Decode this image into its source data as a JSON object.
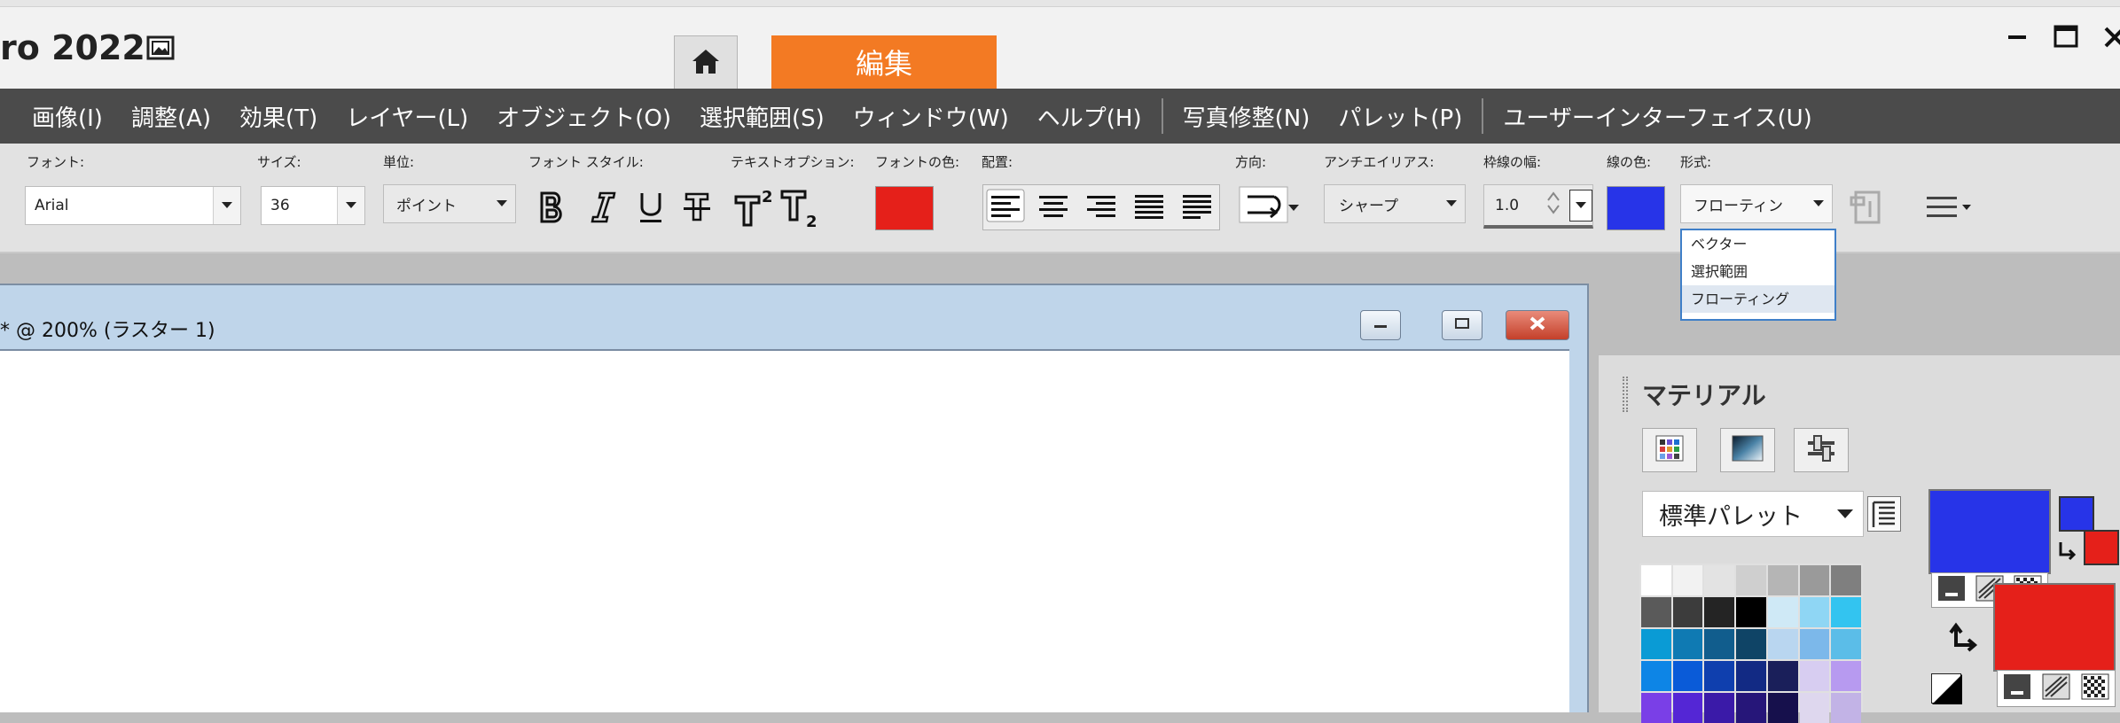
{
  "app": {
    "title": "ro 2022",
    "tabs": {
      "edit": "編集"
    }
  },
  "menu": [
    "画像(I)",
    "調整(A)",
    "効果(T)",
    "レイヤー(L)",
    "オブジェクト(O)",
    "選択範囲(S)",
    "ウィンドウ(W)",
    "ヘルプ(H)",
    "|",
    "写真修整(N)",
    "パレット(P)",
    "|",
    "ユーザーインターフェイス(U)"
  ],
  "toolbar": {
    "labels": {
      "font": "フォント:",
      "size": "サイズ:",
      "unit": "単位:",
      "font_style": "フォント スタイル:",
      "text_options": "テキストオプション:",
      "font_color": "フォントの色:",
      "alignment": "配置:",
      "direction": "方向:",
      "antialias": "アンチエイリアス:",
      "stroke_width": "枠線の幅:",
      "stroke_color": "線の色:",
      "format": "形式:"
    },
    "font": "Arial",
    "size": "36",
    "unit": "ポイント",
    "antialias": "シャープ",
    "stroke_width": "1.0",
    "format": "フローティン",
    "font_color": "#e5201a",
    "stroke_color": "#2734e8"
  },
  "format_dropdown": [
    "ベクター",
    "選択範囲",
    "フローティング"
  ],
  "document": {
    "title": "* @ 200% (ラスター 1)"
  },
  "materials": {
    "title": "マテリアル",
    "palette": "標準パレット",
    "foreground": "#2734e8",
    "background": "#e5201a",
    "swatches": [
      "#ffffff",
      "#f2f2f2",
      "#e3e3e3",
      "#cfcfcf",
      "#b5b5b5",
      "#9a9a9a",
      "#7f7f7f",
      "#5a5a5a",
      "#3c3c3c",
      "#242424",
      "#000000",
      "#cfe9f6",
      "#8fd6f4",
      "#33c4f0",
      "#0a9bd5",
      "#0f7ab3",
      "#115d8d",
      "#0f4466",
      "#b9d6f0",
      "#7cb8ea",
      "#5bbde8",
      "#0d85e6",
      "#0a5bd8",
      "#0f3fae",
      "#122a84",
      "#1a1f5a",
      "#d7cdf1",
      "#b79af0",
      "#7a3fe7",
      "#5426d5",
      "#3a1aa8",
      "#261679",
      "#16104c",
      "#ded7ee",
      "#c2b3e6"
    ]
  }
}
